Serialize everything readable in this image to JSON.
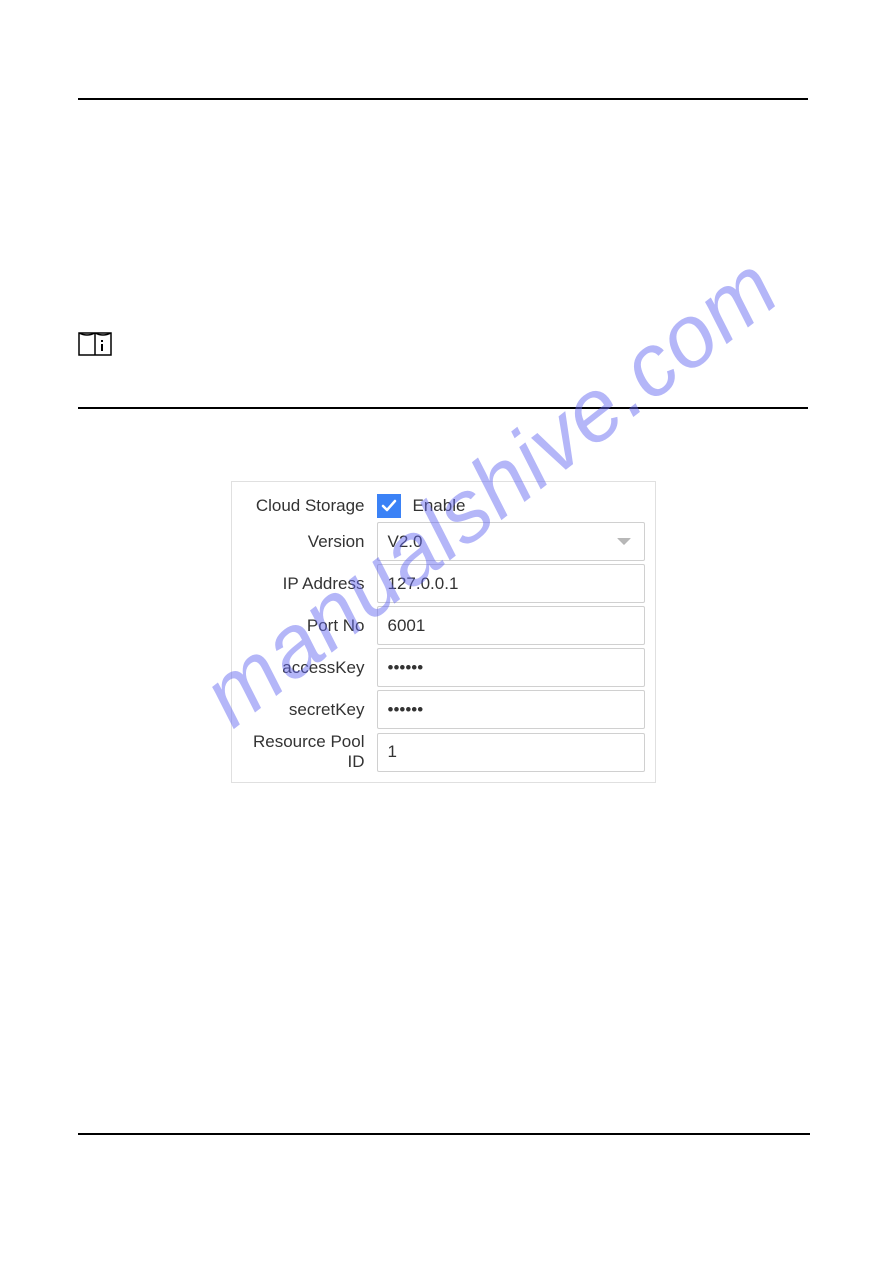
{
  "watermark": "manualshive.com",
  "form": {
    "cloudStorage": {
      "label": "Cloud Storage",
      "enableLabel": "Enable",
      "checked": true
    },
    "version": {
      "label": "Version",
      "value": "V2.0"
    },
    "ipAddress": {
      "label": "IP Address",
      "value": "127.0.0.1"
    },
    "portNo": {
      "label": "Port No",
      "value": "6001"
    },
    "accessKey": {
      "label": "accessKey",
      "value": "••••••"
    },
    "secretKey": {
      "label": "secretKey",
      "value": "••••••"
    },
    "resourcePoolId": {
      "label": "Resource Pool ID",
      "value": "1"
    }
  }
}
